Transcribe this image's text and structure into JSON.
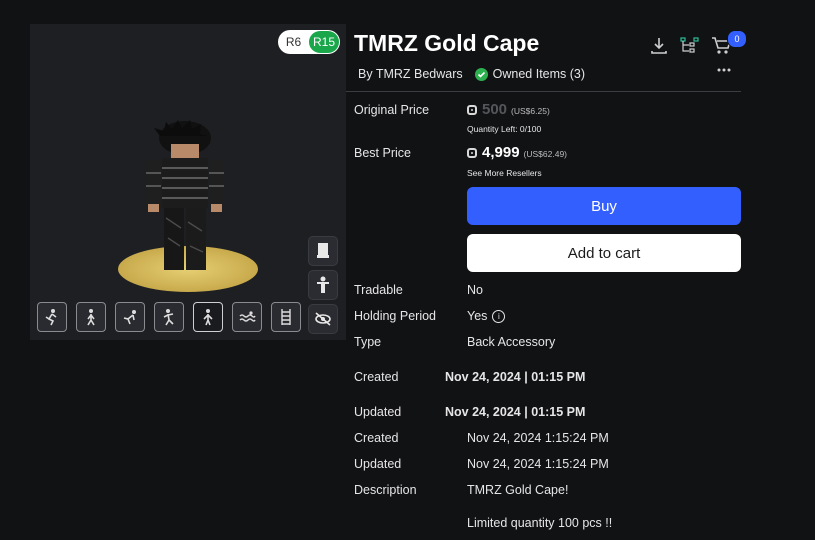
{
  "preview": {
    "rig_options": [
      "R6",
      "R15"
    ],
    "rig_selected": "R15",
    "side_buttons": [
      "flag-icon",
      "avatar-icon",
      "hide-icon"
    ],
    "animations": [
      "climb-icon",
      "walk-icon",
      "fall-icon",
      "idle-icon",
      "stand-icon",
      "swim-icon",
      "ladder-icon"
    ],
    "selected_animation": "stand-icon"
  },
  "item": {
    "title": "TMRZ Gold Cape",
    "creator": "By TMRZ Bedwars",
    "owned_label": "Owned Items (3)",
    "cart_count": "0"
  },
  "pricing": {
    "original_label": "Original Price",
    "original_price": "500",
    "original_usd": "(US$6.25)",
    "quantity_left": "Quantity Left: 0/100",
    "best_label": "Best Price",
    "best_price": "4,999",
    "best_usd": "(US$62.49)",
    "resellers_link": "See More Resellers"
  },
  "actions": {
    "buy": "Buy",
    "add_to_cart": "Add to cart"
  },
  "details": {
    "tradable_label": "Tradable",
    "tradable_value": "No",
    "holding_label": "Holding Period",
    "holding_value": "Yes",
    "type_label": "Type",
    "type_value": "Back Accessory",
    "created_label": "Created",
    "created_value_bold": "Nov 24, 2024 | 01:15 PM",
    "updated_label": "Updated",
    "updated_value_bold": "Nov 24, 2024 | 01:15 PM",
    "created_label2": "Created",
    "created_value": "Nov 24, 2024 1:15:24 PM",
    "updated_label2": "Updated",
    "updated_value": "Nov 24, 2024 1:15:24 PM",
    "description_label": "Description",
    "description_line1": "TMRZ Gold Cape!",
    "description_line2": "Limited quantity 100 pcs !!"
  },
  "colors": {
    "background": "#111214",
    "accent_blue": "#335fff",
    "owned_green": "#2db14f",
    "gold": "#d8bf5c"
  }
}
